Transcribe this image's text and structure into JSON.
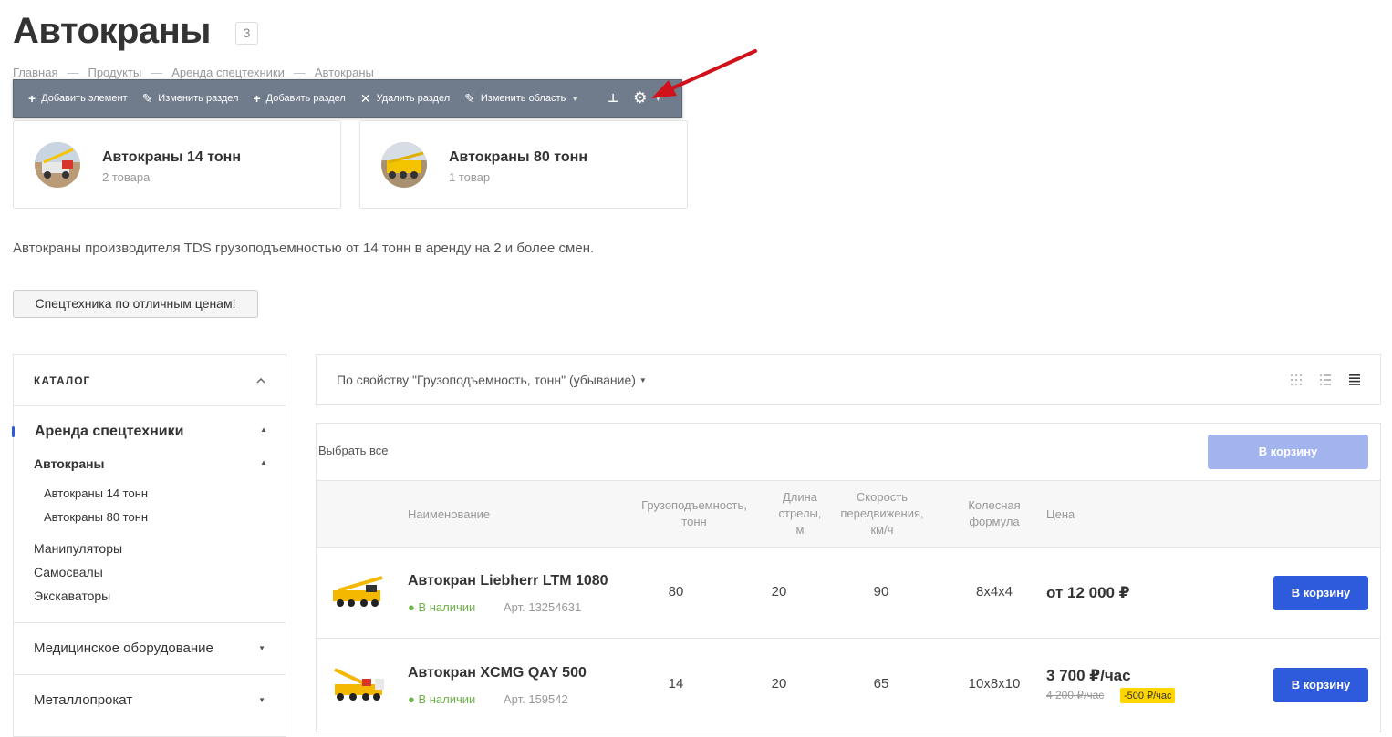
{
  "header": {
    "title": "Автокраны",
    "count": "3"
  },
  "breadcrumbs": [
    "Главная",
    "Продукты",
    "Аренда спецтехники",
    "Автокраны"
  ],
  "breadcrumb_sep": "—",
  "toolbar": {
    "add_element": "Добавить элемент",
    "edit_section": "Изменить раздел",
    "add_section": "Добавить раздел",
    "delete_section": "Удалить раздел",
    "edit_area": "Изменить область"
  },
  "subsections": [
    {
      "name": "Автокраны 14 тонн",
      "count": "2 товара"
    },
    {
      "name": "Автокраны 80 тонн",
      "count": "1 товар"
    }
  ],
  "description": "Автокраны производителя TDS грузоподъемностью от 14 тонн в аренду на 2 и более смен.",
  "promo_button": "Спецтехника по отличным ценам!",
  "sidebar": {
    "title": "КАТАЛОГ",
    "level1": "Аренда спецтехники",
    "level2": "Автокраны",
    "level3": [
      "Автокраны 14 тонн",
      "Автокраны 80 тонн"
    ],
    "siblings": [
      "Манипуляторы",
      "Самосвалы",
      "Экскаваторы"
    ],
    "sections": [
      "Медицинское оборудование",
      "Металлопрокат"
    ]
  },
  "sort": {
    "label": "По свойству \"Грузоподъемность, тонн\" (убывание)"
  },
  "table": {
    "select_all": "Выбрать все",
    "cart_all": "В корзину",
    "headers": {
      "name": "Наименование",
      "capacity_1": "Грузоподъемность,",
      "capacity_2": "тонн",
      "boom_1": "Длина",
      "boom_2": "стрелы,",
      "boom_3": "м",
      "speed_1": "Скорость",
      "speed_2": "передвижения,",
      "speed_3": "км/ч",
      "wheel_1": "Колесная",
      "wheel_2": "формула",
      "price": "Цена"
    },
    "rows": [
      {
        "name": "Автокран Liebherr LTM 1080",
        "stock": "● В наличии",
        "art": "Арт. 13254631",
        "capacity": "80",
        "boom": "20",
        "speed": "90",
        "wheel": "8x4x4",
        "price": "от 12 000 ₽",
        "old_price": "",
        "discount": "",
        "button": "В корзину"
      },
      {
        "name": "Автокран XCMG QAY 500",
        "stock": "● В наличии",
        "art": "Арт. 159542",
        "capacity": "14",
        "boom": "20",
        "speed": "65",
        "wheel": "10x8x10",
        "price": "3 700 ₽/час",
        "old_price": "4 200 ₽/час",
        "discount": "-500 ₽/час",
        "button": "В корзину"
      }
    ]
  },
  "colors": {
    "accent": "#2e5bdb",
    "accent_disabled": "#a2b3ee",
    "stock": "#6fb24a",
    "toolbar": "#707c8b",
    "discount": "#ffd600",
    "arrow": "#d0121b"
  }
}
